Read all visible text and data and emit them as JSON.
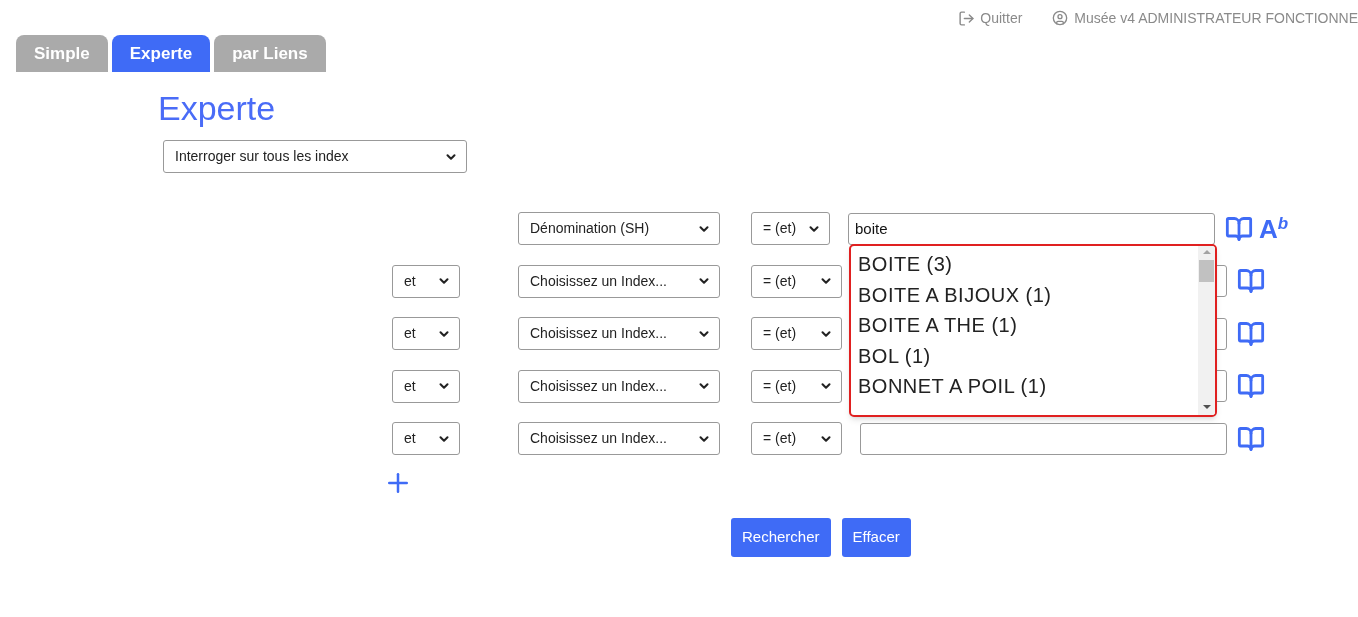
{
  "header": {
    "quit_link": "Quitter",
    "user": "Musée v4 ADMINISTRATEUR FONCTIONNE"
  },
  "tabs": [
    {
      "label": "Simple",
      "selected": false
    },
    {
      "label": "Experte",
      "selected": true
    },
    {
      "label": "par Liens",
      "selected": false
    }
  ],
  "title": "Experte",
  "scope_select": {
    "value": "Interroger sur tous les index"
  },
  "criteria": [
    {
      "index": "Dénomination (SH)",
      "operator": "= (et)",
      "value": "boite",
      "format_button": "A$^{b}$"
    },
    {
      "connector": "et",
      "index": "Choisissez un Index...",
      "operator": "= (et)"
    },
    {
      "connector": "et",
      "index": "Choisissez un Index...",
      "operator": "= (et)"
    },
    {
      "connector": "et",
      "index": "Choisissez un Index...",
      "operator": "= (et)"
    },
    {
      "connector": "et",
      "index": "Choisissez un Index...",
      "operator": "= (et)"
    }
  ],
  "suggestions": [
    "BOITE (3)",
    "BOITE A BIJOUX (1)",
    "BOITE A THE (1)",
    "BOL (1)",
    "BONNET A POIL (1)"
  ],
  "buttons": [
    "Rechercher",
    "Effacer"
  ]
}
